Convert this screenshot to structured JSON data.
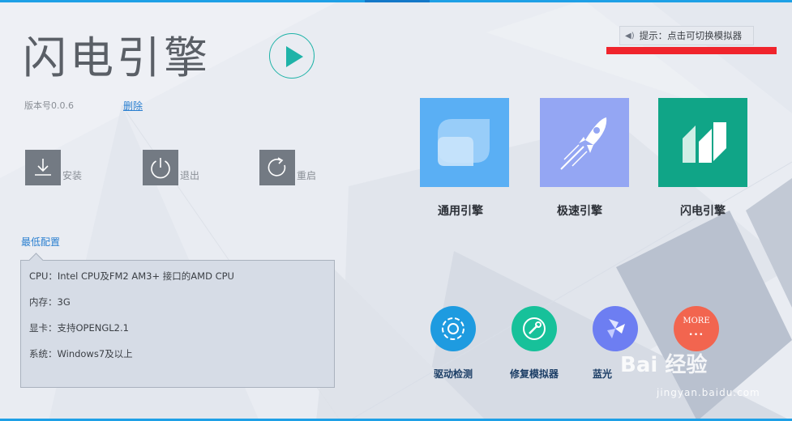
{
  "app": {
    "title": "闪电引擎",
    "version": "版本号0.0.6",
    "delete_label": "删除"
  },
  "actions": [
    {
      "label": "安装",
      "icon": "download-icon"
    },
    {
      "label": "退出",
      "icon": "power-icon"
    },
    {
      "label": "重启",
      "icon": "restart-icon"
    }
  ],
  "hint": {
    "text": "提示：点击可切换模拟器",
    "icon": "speaker-icon"
  },
  "min_config": {
    "link_label": "最低配置",
    "lines": [
      "CPU：Intel CPU及FM2  AM3+ 接口的AMD CPU",
      "内存：3G",
      "显卡：支持OPENGL2.1",
      "系统：Windows7及以上"
    ]
  },
  "engines": [
    {
      "label": "通用引擎",
      "icon": "general-engine-icon",
      "color": "#5aaff4"
    },
    {
      "label": "极速引擎",
      "icon": "rocket-icon",
      "color": "#94a6f3"
    },
    {
      "label": "闪电引擎",
      "icon": "lightning-engine-icon",
      "color": "#10a587"
    }
  ],
  "tools": [
    {
      "label": "驱动检测",
      "icon": "driver-check-icon",
      "color": "#1e9be0"
    },
    {
      "label": "修复模拟器",
      "icon": "repair-icon",
      "color": "#17c19a"
    },
    {
      "label": "蓝光",
      "icon": "bluelight-icon",
      "color": "#6d7ef2"
    },
    {
      "label": "",
      "more_text": "MORE",
      "icon": "more-icon",
      "color": "#f2654f"
    }
  ],
  "watermark": {
    "brand": "Bai 经验",
    "url": "jingyan.baidu.com"
  },
  "colors": {
    "accent": "#1fb3a8",
    "link": "#2a7fd0",
    "topbar": "#1ea0e6",
    "highlight": "#f0242c"
  }
}
